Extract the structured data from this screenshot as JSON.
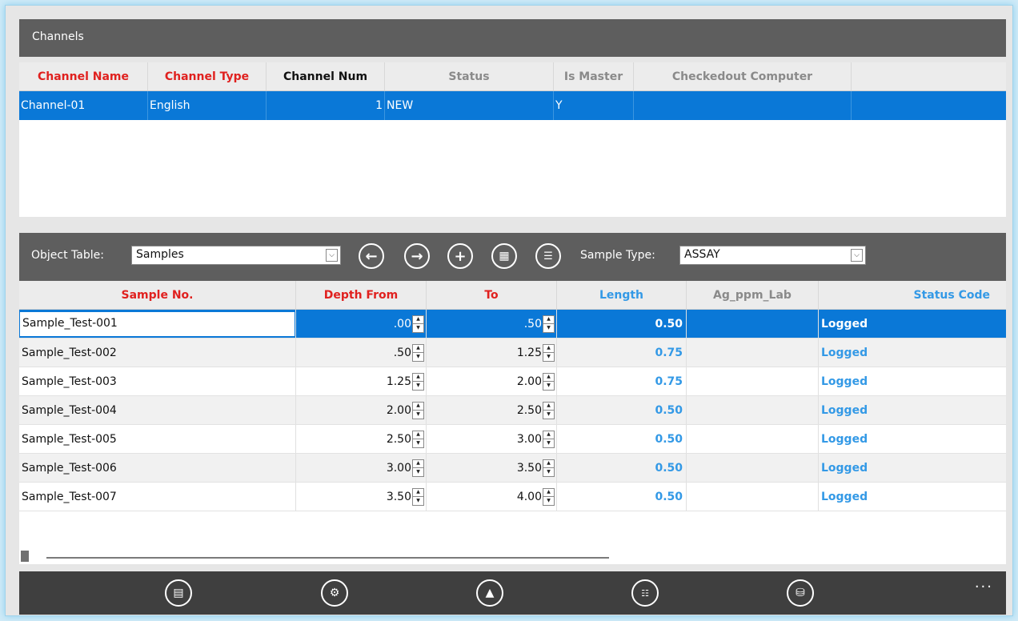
{
  "channels": {
    "title": "Channels",
    "columns": [
      "Channel Name",
      "Channel Type",
      "Channel Num",
      "Status",
      "Is Master",
      "Checkedout Computer"
    ],
    "rows": [
      {
        "name": "Channel-01",
        "type": "English",
        "num": "1",
        "status": "NEW",
        "is_master": "Y",
        "computer": ""
      }
    ]
  },
  "object_bar": {
    "label": "Object Table:",
    "object_table_value": "Samples",
    "sample_type_label": "Sample Type:",
    "sample_type_value": "ASSAY"
  },
  "samples": {
    "columns": [
      "Sample No.",
      "Depth From",
      "To",
      "Length",
      "Ag_ppm_Lab",
      "Status Code"
    ],
    "rows": [
      {
        "sample": "Sample_Test-001",
        "from": ".00",
        "to": ".50",
        "length": "0.50",
        "ag": "",
        "status": "Logged"
      },
      {
        "sample": "Sample_Test-002",
        "from": ".50",
        "to": "1.25",
        "length": "0.75",
        "ag": "",
        "status": "Logged"
      },
      {
        "sample": "Sample_Test-003",
        "from": "1.25",
        "to": "2.00",
        "length": "0.75",
        "ag": "",
        "status": "Logged"
      },
      {
        "sample": "Sample_Test-004",
        "from": "2.00",
        "to": "2.50",
        "length": "0.50",
        "ag": "",
        "status": "Logged"
      },
      {
        "sample": "Sample_Test-005",
        "from": "2.50",
        "to": "3.00",
        "length": "0.50",
        "ag": "",
        "status": "Logged"
      },
      {
        "sample": "Sample_Test-006",
        "from": "3.00",
        "to": "3.50",
        "length": "0.50",
        "ag": "",
        "status": "Logged"
      },
      {
        "sample": "Sample_Test-007",
        "from": "3.50",
        "to": "4.00",
        "length": "0.50",
        "ag": "",
        "status": "Logged"
      }
    ]
  },
  "bottom_bar": {
    "more": "...",
    "icons": [
      "report-icon",
      "microscope-icon",
      "flask-icon",
      "barcode-icon",
      "add-database-icon"
    ]
  },
  "colors": {
    "header_bar": "#5e5e5e",
    "selection": "#0a78d7",
    "required_header": "#e0211f",
    "computed_header": "#3399e6",
    "bottom_bar": "#3f3f3f"
  }
}
